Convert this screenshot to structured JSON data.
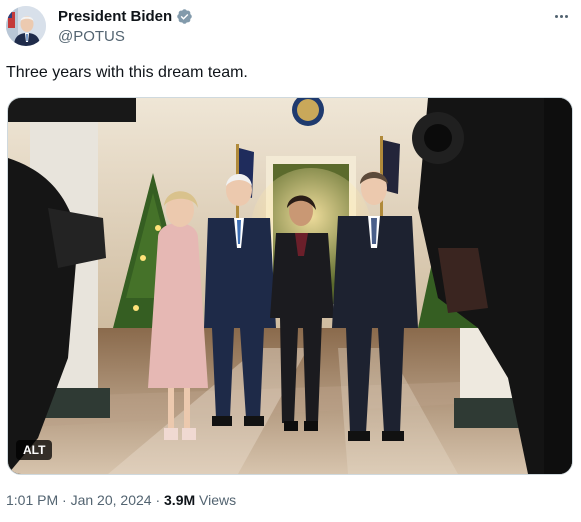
{
  "author": {
    "display_name": "President Biden",
    "handle": "@POTUS",
    "verified": true,
    "verified_color": "#829aab"
  },
  "menu_icon": "more-horizontal-icon",
  "tweet": {
    "text": "Three years with this dream team."
  },
  "media": {
    "alt_badge": "ALT",
    "scene_colors": {
      "walls": "#d9cbb2",
      "trees": "#3f6b28",
      "pink_outfit": "#e8b9b6",
      "navy_suit": "#1e2a48",
      "black_suit": "#1b1b1f",
      "floor": "#c9b39a"
    }
  },
  "meta": {
    "time": "1:01 PM",
    "separator1": "·",
    "date": "Jan 20, 2024",
    "separator2": "·",
    "views_count": "3.9M",
    "views_label": "Views"
  }
}
